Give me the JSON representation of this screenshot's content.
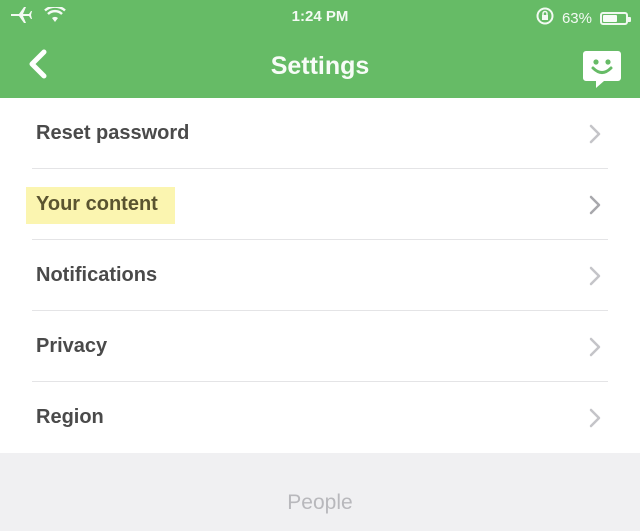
{
  "status_bar": {
    "time": "1:24 PM",
    "battery_text": "63%",
    "battery_level": 0.63,
    "icons": [
      "airplane-icon",
      "wifi-icon",
      "orientation-lock-icon",
      "battery-icon"
    ]
  },
  "nav": {
    "title": "Settings",
    "back_icon": "chevron-left-icon",
    "right_icon": "chat-icon",
    "bar_color": "#66bb66"
  },
  "settings": {
    "items": [
      {
        "label": "Reset password"
      },
      {
        "label": "Your content"
      },
      {
        "label": "Notifications"
      },
      {
        "label": "Privacy"
      },
      {
        "label": "Region"
      }
    ],
    "highlight_color": "#fbf5b0"
  },
  "section": {
    "header": "People"
  }
}
